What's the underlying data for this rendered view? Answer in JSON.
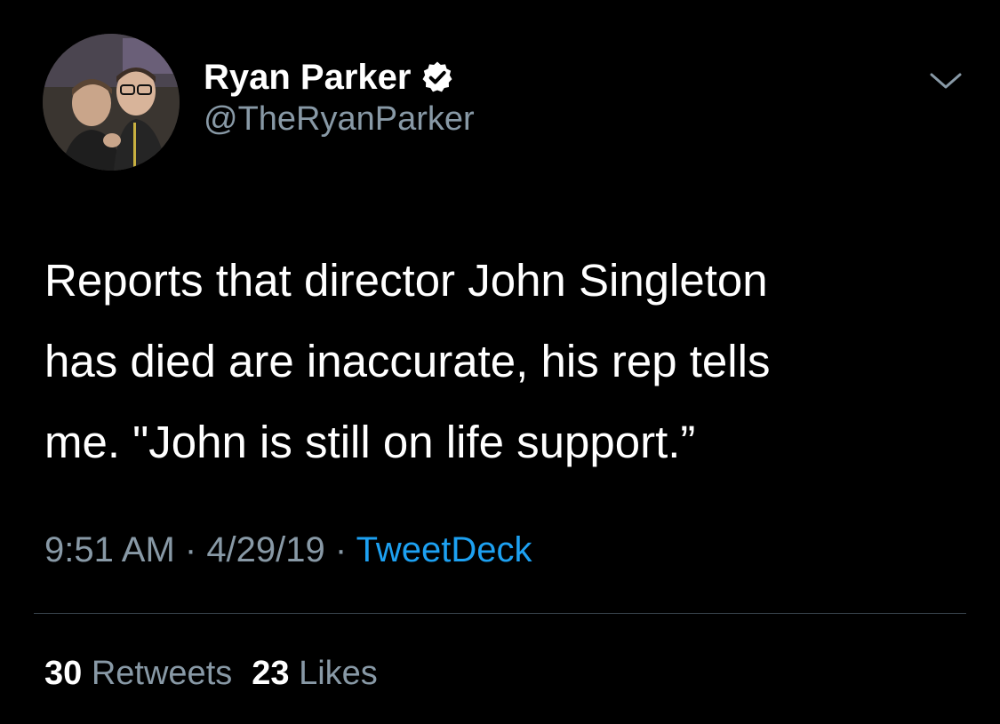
{
  "author": {
    "display_name": "Ryan Parker",
    "handle": "@TheRyanParker",
    "verified": true,
    "verified_color": "#ffffff",
    "avatar_icon": "profile-photo"
  },
  "menu": {
    "icon": "chevron-down-icon"
  },
  "tweet": {
    "lines": [
      "Reports that director John Singleton",
      "has died are inaccurate, his rep tells",
      "me. \"John is still on life support.”"
    ]
  },
  "meta": {
    "time": "9:51 AM",
    "separator": " · ",
    "date": "4/29/19",
    "source": "TweetDeck",
    "source_color": "#1da1f2"
  },
  "stats": {
    "retweets_count": "30",
    "retweets_label": "Retweets",
    "likes_count": "23",
    "likes_label": "Likes"
  },
  "colors": {
    "background": "#000000",
    "secondary_text": "#8899a6",
    "divider": "#38444d"
  }
}
